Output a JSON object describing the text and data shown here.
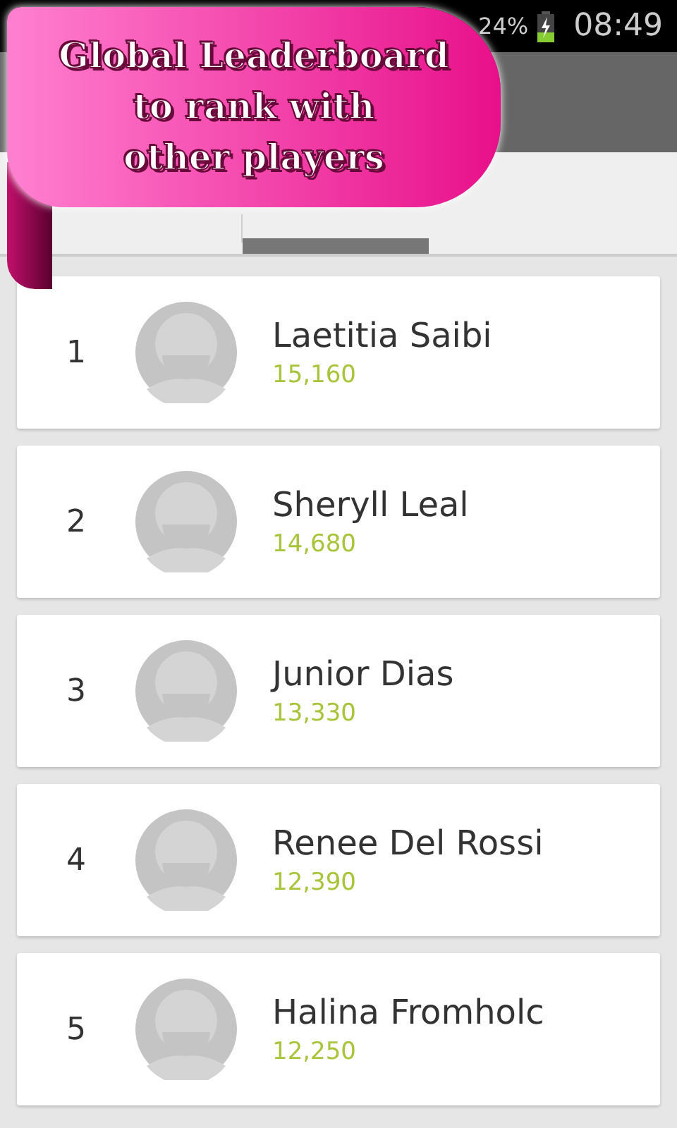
{
  "status_bar": {
    "battery": "24%",
    "time": "08:49"
  },
  "banner": {
    "lines": [
      "Global Leaderboard",
      "to rank with",
      "other players"
    ]
  },
  "tabs": [
    {
      "selected": false
    },
    {
      "selected": true
    }
  ],
  "players": [
    {
      "rank": "1",
      "name": "Laetitia Saibi",
      "score": "15,160"
    },
    {
      "rank": "2",
      "name": "Sheryll Leal",
      "score": "14,680"
    },
    {
      "rank": "3",
      "name": "Junior Dias",
      "score": "13,330"
    },
    {
      "rank": "4",
      "name": "Renee Del Rossi",
      "score": "12,390"
    },
    {
      "rank": "5",
      "name": "Halina Fromholc",
      "score": "12,250"
    }
  ]
}
